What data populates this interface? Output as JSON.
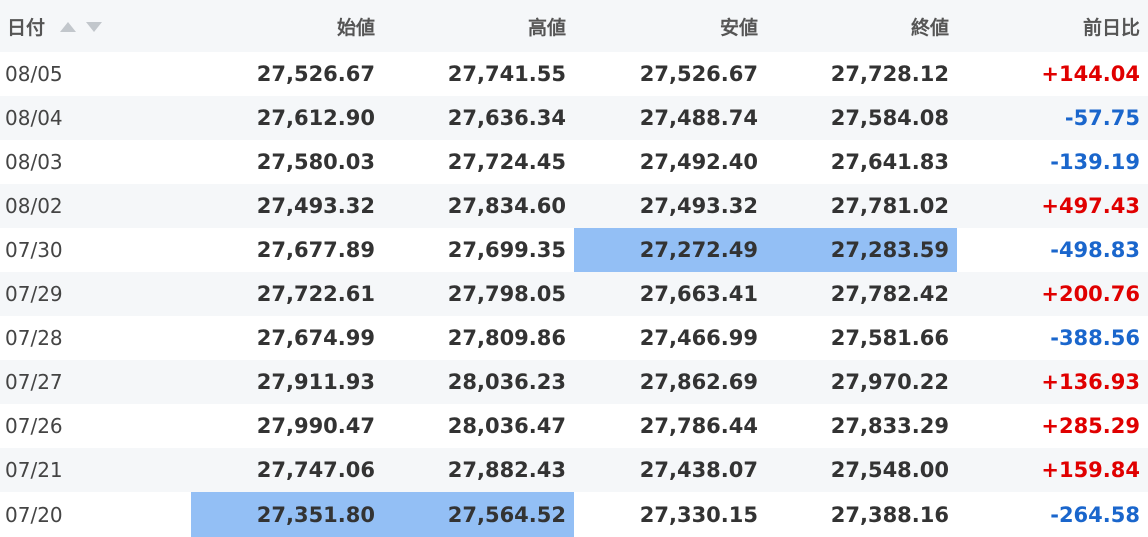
{
  "table": {
    "headers": [
      "日付",
      "始値",
      "高値",
      "安値",
      "終値",
      "前日比"
    ],
    "sort_icons": [
      "sort-asc-icon",
      "sort-desc-icon"
    ],
    "rows": [
      {
        "date": "08/05",
        "cells": [
          "27,526.67",
          "27,741.55",
          "27,526.67",
          "27,728.12",
          "+144.04"
        ],
        "highlight": [],
        "trend": "up"
      },
      {
        "date": "08/04",
        "cells": [
          "27,612.90",
          "27,636.34",
          "27,488.74",
          "27,584.08",
          "-57.75"
        ],
        "highlight": [],
        "trend": "down"
      },
      {
        "date": "08/03",
        "cells": [
          "27,580.03",
          "27,724.45",
          "27,492.40",
          "27,641.83",
          "-139.19"
        ],
        "highlight": [],
        "trend": "down"
      },
      {
        "date": "08/02",
        "cells": [
          "27,493.32",
          "27,834.60",
          "27,493.32",
          "27,781.02",
          "+497.43"
        ],
        "highlight": [],
        "trend": "up"
      },
      {
        "date": "07/30",
        "cells": [
          "27,677.89",
          "27,699.35",
          "27,272.49",
          "27,283.59",
          "-498.83"
        ],
        "highlight": [
          2,
          3
        ],
        "trend": "down"
      },
      {
        "date": "07/29",
        "cells": [
          "27,722.61",
          "27,798.05",
          "27,663.41",
          "27,782.42",
          "+200.76"
        ],
        "highlight": [],
        "trend": "up"
      },
      {
        "date": "07/28",
        "cells": [
          "27,674.99",
          "27,809.86",
          "27,466.99",
          "27,581.66",
          "-388.56"
        ],
        "highlight": [],
        "trend": "down"
      },
      {
        "date": "07/27",
        "cells": [
          "27,911.93",
          "28,036.23",
          "27,862.69",
          "27,970.22",
          "+136.93"
        ],
        "highlight": [],
        "trend": "up"
      },
      {
        "date": "07/26",
        "cells": [
          "27,990.47",
          "28,036.47",
          "27,786.44",
          "27,833.29",
          "+285.29"
        ],
        "highlight": [],
        "trend": "up"
      },
      {
        "date": "07/21",
        "cells": [
          "27,747.06",
          "27,882.43",
          "27,438.07",
          "27,548.00",
          "+159.84"
        ],
        "highlight": [],
        "trend": "up"
      },
      {
        "date": "07/20",
        "cells": [
          "27,351.80",
          "27,564.52",
          "27,330.15",
          "27,388.16",
          "-264.58"
        ],
        "highlight": [
          0,
          1
        ],
        "trend": "down"
      }
    ]
  },
  "colors": {
    "up": "#e00000",
    "down": "#1a66cc",
    "highlight": "#93bff5",
    "header_bg": "#f5f7f9",
    "row_alt_bg": "#f5f7f9"
  }
}
